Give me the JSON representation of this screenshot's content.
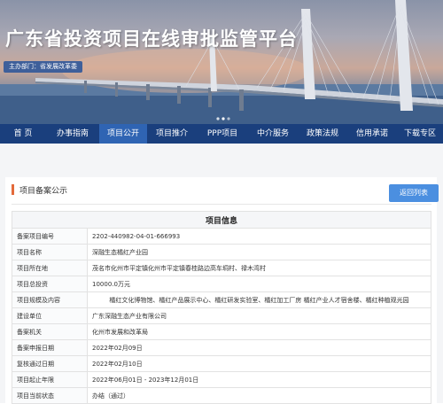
{
  "banner": {
    "title": "广东省投资项目在线审批监管平台",
    "subtitle": "主办部门：省发展改革委"
  },
  "nav": {
    "items": [
      {
        "label": "首  页",
        "active": false
      },
      {
        "label": "办事指南",
        "active": false
      },
      {
        "label": "项目公开",
        "active": true
      },
      {
        "label": "项目推介",
        "active": false
      },
      {
        "label": "PPP项目",
        "active": false
      },
      {
        "label": "中介服务",
        "active": false
      },
      {
        "label": "政策法规",
        "active": false
      },
      {
        "label": "信用承诺",
        "active": false
      },
      {
        "label": "下载专区",
        "active": false
      }
    ]
  },
  "section": {
    "title": "项目备案公示",
    "back_label": "返回列表"
  },
  "table": {
    "header": "项目信息",
    "rows": [
      {
        "key": "备案项目编号",
        "value": "2202-440982-04-01-666993",
        "center": false
      },
      {
        "key": "项目名称",
        "value": "深融生态橘红产业园",
        "center": false
      },
      {
        "key": "项目所在地",
        "value": "茂名市化州市平定镇化州市平定镇春桂路边高车垌村、禄木湾村",
        "center": false
      },
      {
        "key": "项目总投资",
        "value": "10000.0万元",
        "center": false
      },
      {
        "key": "项目规模及内容",
        "value": "橘红文化博物馆、橘红产品展示中心、橘红研发实验室、橘红加工厂房 橘红产业人才宿舍楼、橘红种植观光园",
        "center": true
      },
      {
        "key": "建设单位",
        "value": "广东深融生态产业有限公司",
        "center": false
      },
      {
        "key": "备案机关",
        "value": "化州市发展和改革局",
        "center": false
      },
      {
        "key": "备案申报日期",
        "value": "2022年02月09日",
        "center": false
      },
      {
        "key": "复核通过日期",
        "value": "2022年02月10日",
        "center": false
      },
      {
        "key": "项目起止年限",
        "value": "2022年06月01日 - 2023年12月01日",
        "center": false
      },
      {
        "key": "项目当前状态",
        "value": "办结（通过）",
        "center": false
      }
    ]
  }
}
